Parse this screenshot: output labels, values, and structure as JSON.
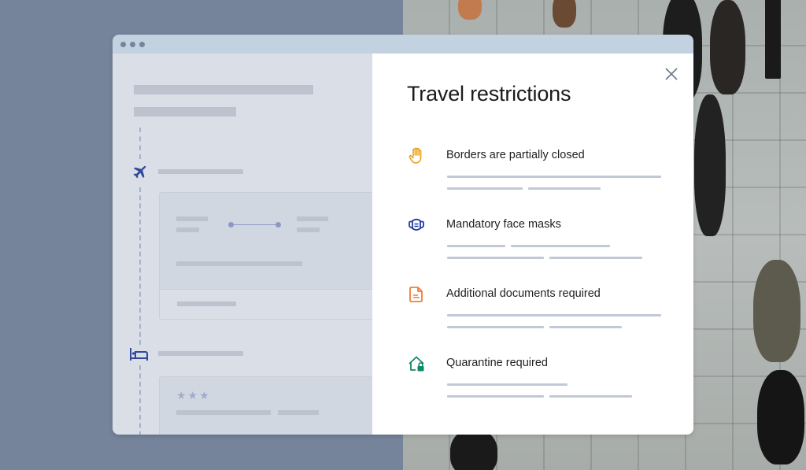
{
  "window": {
    "title_dots": 3
  },
  "modal": {
    "title": "Travel restrictions",
    "close_label": "Close",
    "items": [
      {
        "label": "Borders are partially closed",
        "icon": "hand-stop-icon",
        "color": "#e8a21a"
      },
      {
        "label": "Mandatory face masks",
        "icon": "face-mask-icon",
        "color": "#1e3a9e"
      },
      {
        "label": "Additional documents required",
        "icon": "document-icon",
        "color": "#f07e35"
      },
      {
        "label": "Quarantine required",
        "icon": "house-lock-icon",
        "color": "#0f8a6a"
      }
    ]
  },
  "itinerary": {
    "segments": [
      {
        "icon": "airplane-icon"
      },
      {
        "icon": "hotel-bed-icon",
        "stars": "★★★"
      }
    ]
  },
  "colors": {
    "background": "#75849b",
    "titlebar": "#c3d2e1",
    "left_panel": "#d9dee7",
    "itinerary_icon": "#2f4a9a"
  }
}
